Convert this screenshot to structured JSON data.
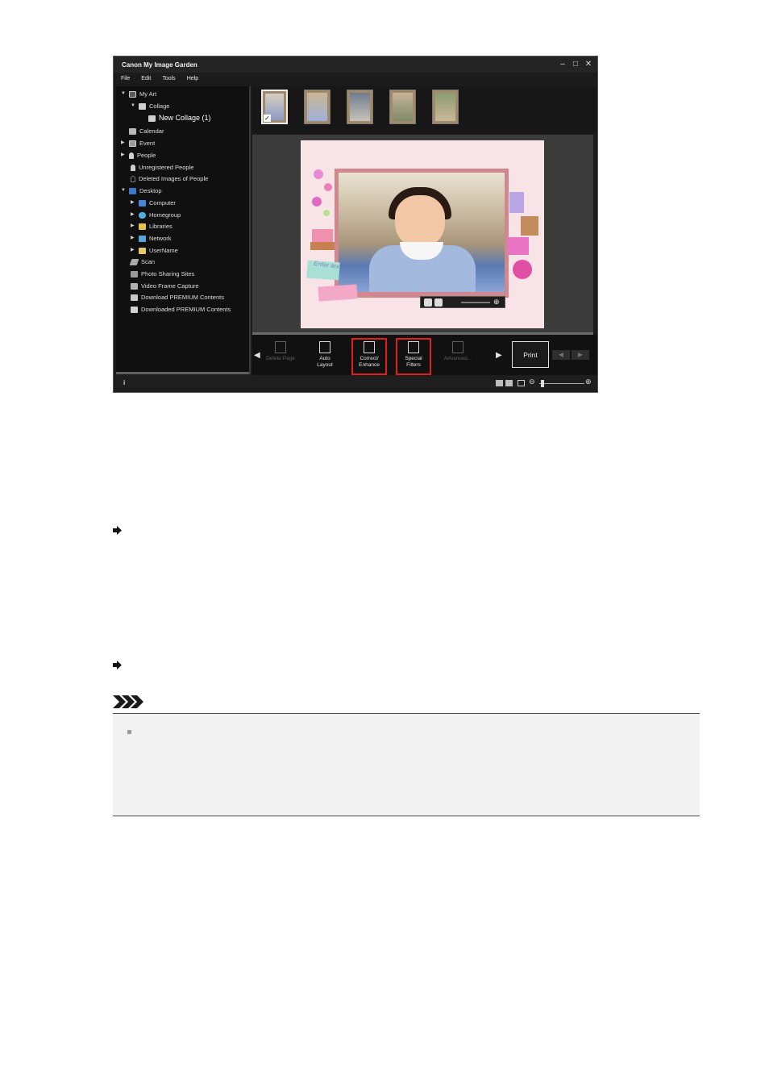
{
  "window": {
    "title": "Canon My Image Garden"
  },
  "menu": [
    "File",
    "Edit",
    "Tools",
    "Help"
  ],
  "tree": [
    {
      "label": "My Art",
      "icon": "my-art-icon",
      "expanded": true
    },
    {
      "label": "Collage",
      "icon": "collage-icon",
      "expanded": true
    },
    {
      "label": "New Collage (1)",
      "icon": "new-collage-icon",
      "selected": true
    },
    {
      "label": "Calendar",
      "icon": "calendar-icon"
    },
    {
      "label": "Event",
      "icon": "event-icon",
      "expanded": false
    },
    {
      "label": "People",
      "icon": "people-icon",
      "expanded": false
    },
    {
      "label": "Unregistered People",
      "icon": "unregistered-people-icon"
    },
    {
      "label": "Deleted Images of People",
      "icon": "deleted-people-icon"
    },
    {
      "label": "Desktop",
      "icon": "desktop-icon",
      "expanded": true
    },
    {
      "label": "Computer",
      "icon": "computer-icon",
      "expanded": false
    },
    {
      "label": "Homegroup",
      "icon": "homegroup-icon",
      "expanded": false
    },
    {
      "label": "Libraries",
      "icon": "libraries-icon",
      "expanded": false
    },
    {
      "label": "Network",
      "icon": "network-icon",
      "expanded": false
    },
    {
      "label": "UserName",
      "icon": "user-folder-icon",
      "expanded": false
    },
    {
      "label": "Scan",
      "icon": "scan-icon"
    },
    {
      "label": "Photo Sharing Sites",
      "icon": "photo-sharing-icon"
    },
    {
      "label": "Video Frame Capture",
      "icon": "video-frame-icon"
    },
    {
      "label": "Download PREMIUM Contents",
      "icon": "download-premium-icon"
    },
    {
      "label": "Downloaded PREMIUM Contents",
      "icon": "downloaded-premium-icon"
    }
  ],
  "thumbnails": {
    "count": 5,
    "selected_index": 0
  },
  "canvas": {
    "placeholder_text": "Enter tex"
  },
  "actions": [
    {
      "label1": "Delete Page",
      "label2": "",
      "enabled": false,
      "highlighted": false
    },
    {
      "label1": "Auto",
      "label2": "Layout",
      "enabled": true,
      "highlighted": false
    },
    {
      "label1": "Correct/",
      "label2": "Enhance",
      "enabled": true,
      "highlighted": true
    },
    {
      "label1": "Special",
      "label2": "Filters",
      "enabled": true,
      "highlighted": true
    },
    {
      "label1": "Advanced...",
      "label2": "",
      "enabled": false,
      "highlighted": false
    }
  ],
  "print_label": "Print",
  "colors": {
    "highlight": "#e31c1c",
    "app_bg": "#1b1b1b",
    "canvas_bg": "#f8e4e6"
  }
}
